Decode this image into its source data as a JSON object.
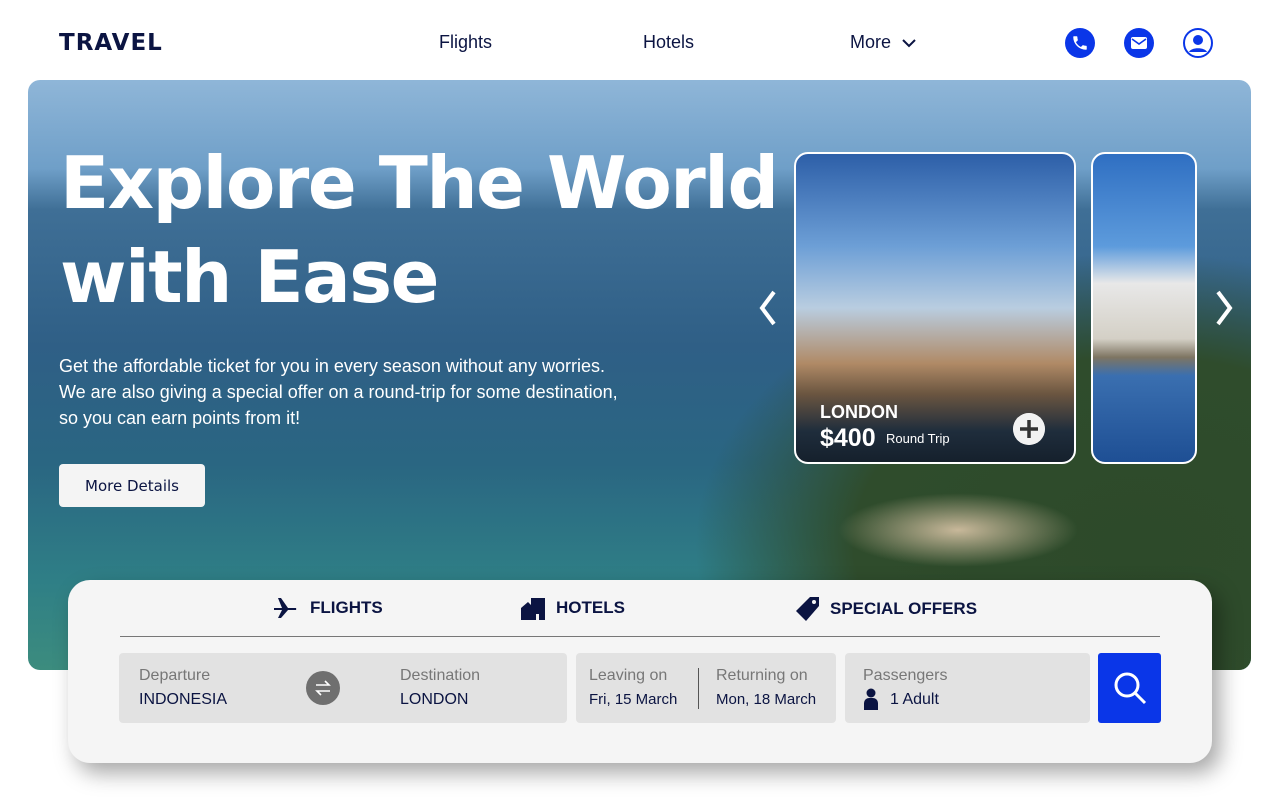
{
  "header": {
    "logo": "TRAVEL",
    "nav": [
      "Flights",
      "Hotels",
      "More"
    ],
    "icons": [
      "phone-icon",
      "mail-icon",
      "user-icon"
    ]
  },
  "hero": {
    "title_line1": "Explore The World",
    "title_line2": "with Ease",
    "description": [
      "Get the affordable ticket for you in every season without any worries.",
      "We are also giving a special offer on a round-trip for some destination,",
      "so you can earn points from it!"
    ],
    "button": "More Details"
  },
  "carousel": {
    "cards": [
      {
        "city": "LONDON",
        "price": "$400",
        "trip": "Round Trip"
      }
    ]
  },
  "search": {
    "tabs": [
      "FLIGHTS",
      "HOTELS",
      "SPECIAL OFFERS"
    ],
    "departure": {
      "label": "Departure",
      "value": "INDONESIA"
    },
    "destination": {
      "label": "Destination",
      "value": "LONDON"
    },
    "leaving": {
      "label": "Leaving on",
      "value": "Fri, 15 March"
    },
    "returning": {
      "label": "Returning on",
      "value": "Mon, 18 March"
    },
    "passengers": {
      "label": "Passengers",
      "value": "1 Adult"
    }
  },
  "colors": {
    "accent": "#0a36e8",
    "text": "#0b1442"
  }
}
